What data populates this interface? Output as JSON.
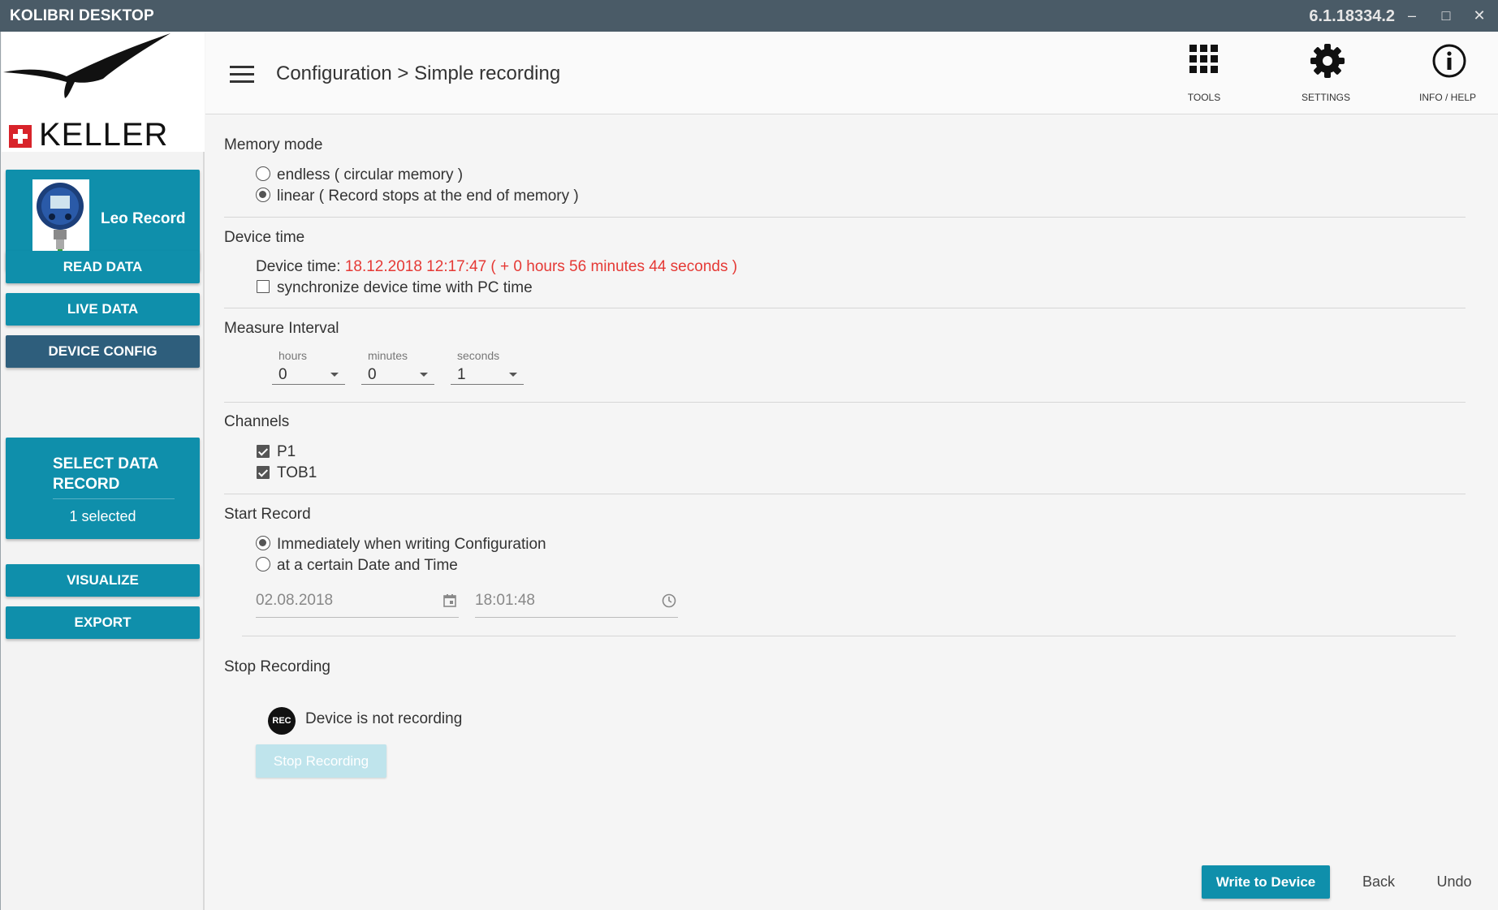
{
  "window": {
    "title": "KOLIBRI DESKTOP",
    "version": "6.1.18334.2",
    "minimize": "‒",
    "maximize": "□",
    "close": "✕"
  },
  "sidebar": {
    "brand": "KELLER",
    "device_name": "Leo Record",
    "buttons": {
      "read_data": "READ DATA",
      "live_data": "LIVE DATA",
      "device_config": "DEVICE CONFIG",
      "select_data_record": "SELECT DATA RECORD",
      "selected_count": "1  selected",
      "visualize": "VISUALIZE",
      "export": "EXPORT"
    }
  },
  "header": {
    "breadcrumb": "Configuration > Simple recording",
    "tools_label": "TOOLS",
    "settings_label": "SETTINGS",
    "info_label": "INFO / HELP"
  },
  "memory_mode": {
    "title": "Memory mode",
    "options": [
      {
        "label": "endless ( circular memory )",
        "selected": false
      },
      {
        "label": "linear ( Record stops at the end of memory )",
        "selected": true
      }
    ]
  },
  "device_time": {
    "title": "Device time",
    "label": "Device time: ",
    "value": "18.12.2018 12:17:47 ( + 0 hours 56 minutes 44 seconds )",
    "sync_label": "synchronize device time with PC time",
    "sync_checked": false
  },
  "measure_interval": {
    "title": "Measure Interval",
    "hours_label": "hours",
    "hours_value": "0",
    "minutes_label": "minutes",
    "minutes_value": "0",
    "seconds_label": "seconds",
    "seconds_value": "1"
  },
  "channels": {
    "title": "Channels",
    "items": [
      {
        "label": "P1",
        "checked": true
      },
      {
        "label": "TOB1",
        "checked": true
      }
    ]
  },
  "start_record": {
    "title": "Start Record",
    "options": [
      {
        "label": "Immediately when writing Configuration",
        "selected": true
      },
      {
        "label": "at a certain Date and Time",
        "selected": false
      }
    ],
    "date": "02.08.2018",
    "time": "18:01:48"
  },
  "stop_recording": {
    "title": "Stop Recording",
    "rec_icon": "REC",
    "status": "Device is not recording",
    "button": "Stop Recording"
  },
  "footer": {
    "write": "Write to Device",
    "back": "Back",
    "undo": "Undo"
  },
  "colors": {
    "accent": "#0f8fab",
    "active_nav": "#2e5e7c",
    "titlebar": "#4a5b67",
    "warning_text": "#e53935"
  }
}
